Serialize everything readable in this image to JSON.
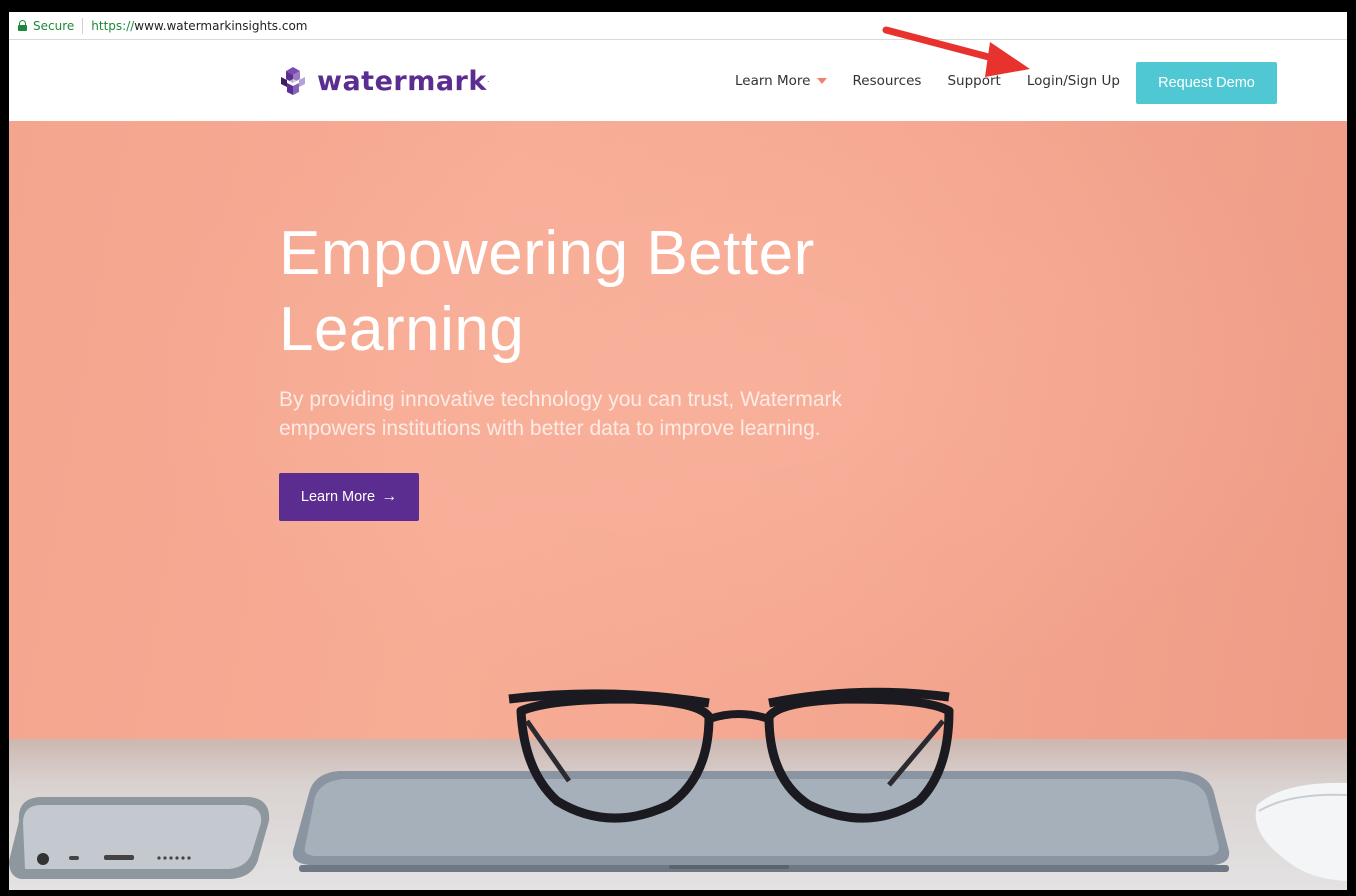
{
  "browser": {
    "security_label": "Secure",
    "url_scheme": "https://",
    "url_host": "www.watermarkinsights.com"
  },
  "site": {
    "logo_text": "watermark",
    "logo_tm": "·",
    "nav": {
      "learn_more": "Learn More",
      "resources": "Resources",
      "support": "Support",
      "login": "Login/Sign Up",
      "request_demo": "Request Demo"
    },
    "colors": {
      "brand_purple": "#5b2d90",
      "demo_teal": "#4fc8d4",
      "hero_salmon": "#f7ac95",
      "caret_orange": "#f2836b",
      "annotation_red": "#e8322e"
    }
  },
  "hero": {
    "title_line1": "Empowering Better",
    "title_line2": "Learning",
    "subtitle_line1": "By providing innovative technology you can trust, Watermark",
    "subtitle_line2": "empowers institutions with better data to improve learning.",
    "cta_label": "Learn More",
    "cta_arrow": "→"
  },
  "icons": {
    "lock": "lock-icon",
    "logo": "watermark-logo-icon",
    "caret": "caret-down-icon",
    "arrow": "arrow-right-icon",
    "annotation": "red-arrow-annotation"
  }
}
